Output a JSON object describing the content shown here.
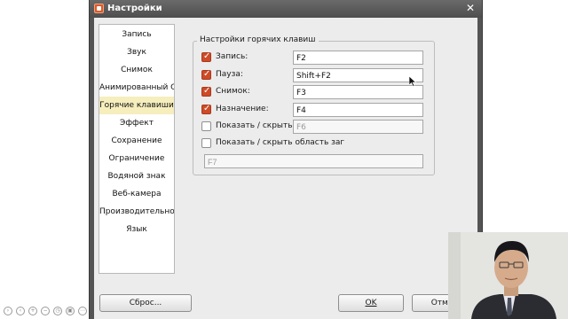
{
  "window": {
    "title": "Настройки"
  },
  "sidebar": {
    "items": [
      {
        "label": "Запись"
      },
      {
        "label": "Звук"
      },
      {
        "label": "Снимок"
      },
      {
        "label": "Анимированный GIF"
      },
      {
        "label": "Горячие клавиши",
        "selected": true
      },
      {
        "label": "Эффект"
      },
      {
        "label": "Сохранение"
      },
      {
        "label": "Ограничение"
      },
      {
        "label": "Водяной знак"
      },
      {
        "label": "Веб-камера"
      },
      {
        "label": "Производительность"
      },
      {
        "label": "Язык"
      }
    ]
  },
  "hotkeys": {
    "group_title": "Настройки горячих клавиш",
    "rows": [
      {
        "label": "Запись:",
        "checked": true,
        "value": "F2"
      },
      {
        "label": "Пауза:",
        "checked": true,
        "value": "Shift+F2"
      },
      {
        "label": "Снимок:",
        "checked": true,
        "value": "F3"
      },
      {
        "label": "Назначение:",
        "checked": true,
        "value": "F4"
      },
      {
        "label": "Показать / скрыть FF",
        "checked": false,
        "value": "F6"
      },
      {
        "label": "Показать / скрыть область заг",
        "checked": false,
        "value": "F7"
      }
    ]
  },
  "buttons": {
    "reset": "Сброс...",
    "ok": "OK",
    "cancel": "Отмен"
  },
  "colors": {
    "checkbox_checked": "#ce4b28",
    "sidebar_selected": "#f6eebd",
    "titlebar": "#545454"
  }
}
